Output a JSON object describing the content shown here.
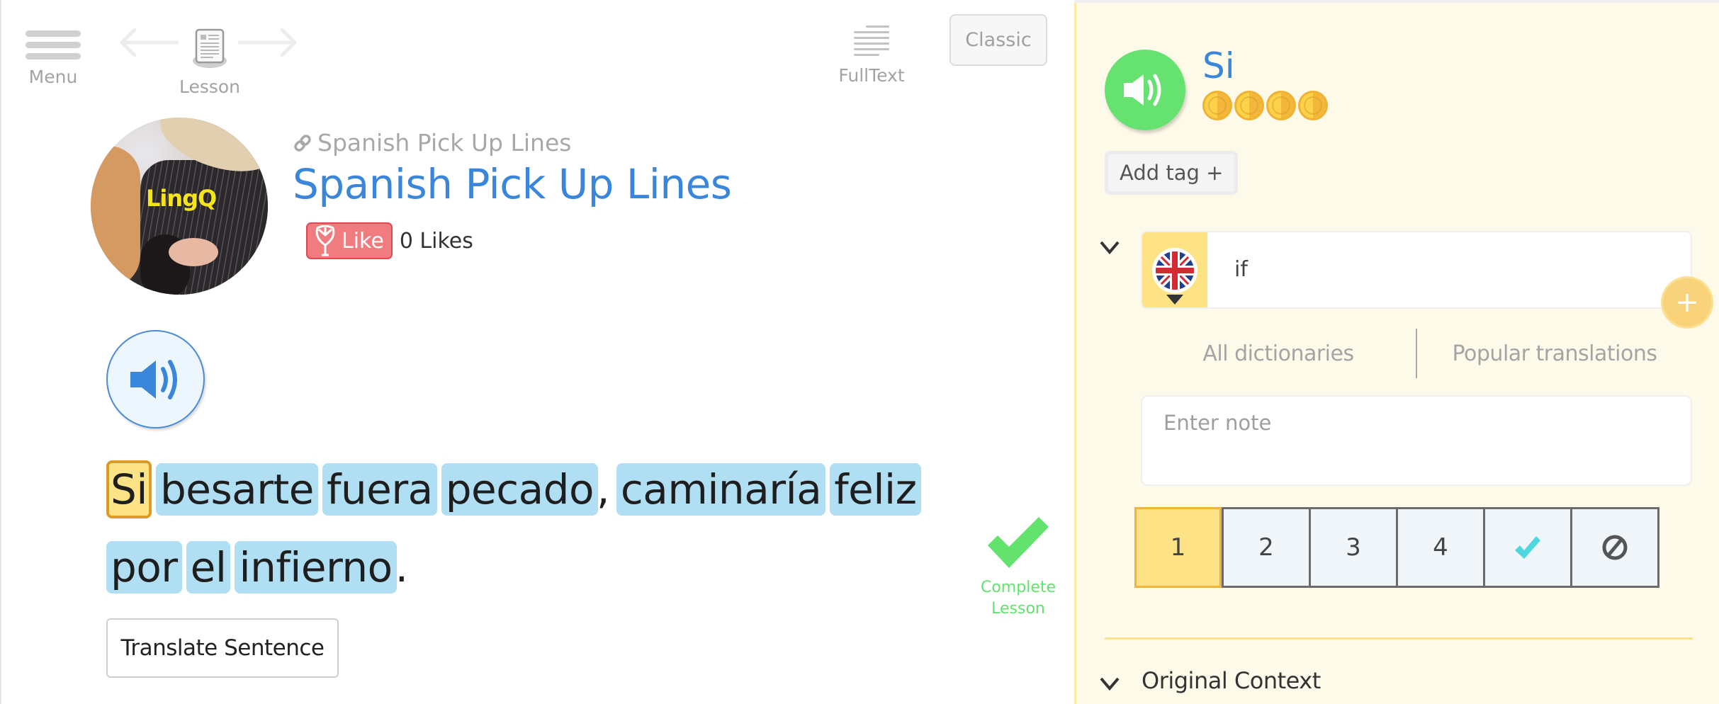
{
  "topbar": {
    "menu_label": "Menu",
    "lesson_label": "Lesson",
    "fulltext_label": "FullText",
    "classic_label": "Classic"
  },
  "lesson": {
    "course_name": "Spanish Pick Up Lines",
    "title": "Spanish Pick Up Lines",
    "avatar_logo_text": "LingQ",
    "like_label": "Like",
    "likes_count": "0 Likes",
    "sentence_words": [
      {
        "text": "Si",
        "status": "selected"
      },
      {
        "text": "besarte",
        "status": "new"
      },
      {
        "text": "fuera",
        "status": "new"
      },
      {
        "text": "pecado",
        "status": "new",
        "after": ","
      },
      {
        "text": "caminaría",
        "status": "new"
      },
      {
        "text": "feliz",
        "status": "new"
      },
      {
        "text": "por",
        "status": "new"
      },
      {
        "text": "el",
        "status": "new"
      },
      {
        "text": "infierno",
        "status": "new",
        "after": "."
      }
    ],
    "translate_button_label": "Translate Sentence",
    "complete_label_line1": "Complete",
    "complete_label_line2": "Lesson"
  },
  "panel": {
    "term": "Si",
    "coin_count": 4,
    "add_tag_label": "Add tag +",
    "hint_language": "English",
    "hint_value": "if",
    "plus_label": "+",
    "dict_tabs": [
      "All dictionaries",
      "Popular translations"
    ],
    "note_placeholder": "Enter note",
    "status_options": [
      {
        "label": "1",
        "active": true
      },
      {
        "label": "2",
        "active": false
      },
      {
        "label": "3",
        "active": false
      },
      {
        "label": "4",
        "active": false
      },
      {
        "label": "known",
        "icon": "check-icon",
        "active": false
      },
      {
        "label": "ignore",
        "icon": "ban-icon",
        "active": false
      }
    ],
    "context_label": "Original Context"
  },
  "colors": {
    "accent_blue": "#3a86db",
    "word_new_bg": "#b0def3",
    "word_selected_bg": "#fde385",
    "word_selected_border": "#dc9b27",
    "complete_green": "#63e26e",
    "panel_bg": "#fefae9",
    "like_red": "#f07c80",
    "known_check": "#4fd7e0"
  }
}
